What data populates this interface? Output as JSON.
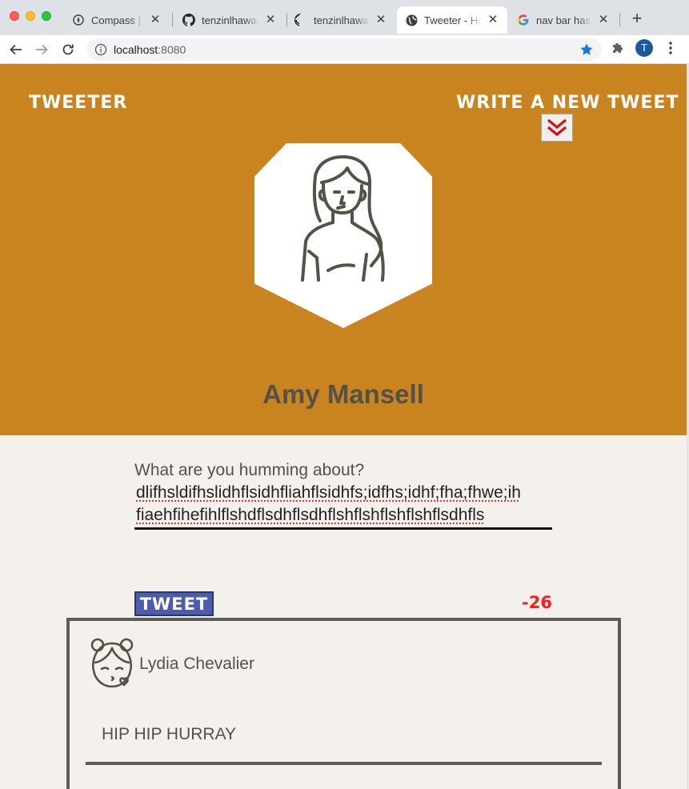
{
  "browser": {
    "tabs": [
      {
        "title": "Compass | Re",
        "favicon": "compass-icon",
        "active": false
      },
      {
        "title": "tenzinlhawan",
        "favicon": "github-icon",
        "active": false
      },
      {
        "title": "tenzinlhawan",
        "favicon": "github-icon",
        "active": false
      },
      {
        "title": "Tweeter - Ho",
        "favicon": "globe-icon",
        "active": true
      },
      {
        "title": "nav bar has p",
        "favicon": "google-icon",
        "active": false
      }
    ],
    "close_glyph": "✕",
    "new_tab_glyph": "+",
    "address": {
      "host": "localhost",
      "port": ":8080"
    },
    "profile_initial": "T",
    "colors": {
      "tabstrip": "#dee1e6",
      "bookmark_star": "#1a73e8",
      "profile": "#1a5a9c"
    }
  },
  "page": {
    "brand": "Tweeter",
    "compose_link": "Write a new tweet",
    "profile": {
      "name": "Amy Mansell",
      "avatar_icon": "woman-avatar-icon"
    },
    "compose": {
      "prompt": "What are you humming about?",
      "text_lines": [
        "dlifhsldifhslidhflsidhfliahflsidhfs;idfhs;idhf;fha;fhwe;ih",
        "fiaehfihefihlflshdflsdhflsdhflshflshflshflshflsdhfls"
      ],
      "submit_label": "Tweet",
      "counter": "-26"
    },
    "tweets": [
      {
        "author": "Lydia Chevalier",
        "avatar_icon": "girl-kiss-avatar-icon",
        "content": "HIP HIP HURRAY"
      }
    ],
    "colors": {
      "header": "#c9841f",
      "background": "#f4f1ec",
      "button": "#4b5eab",
      "counter_negative": "#ff1a1a",
      "chevron": "#d0111b"
    }
  }
}
